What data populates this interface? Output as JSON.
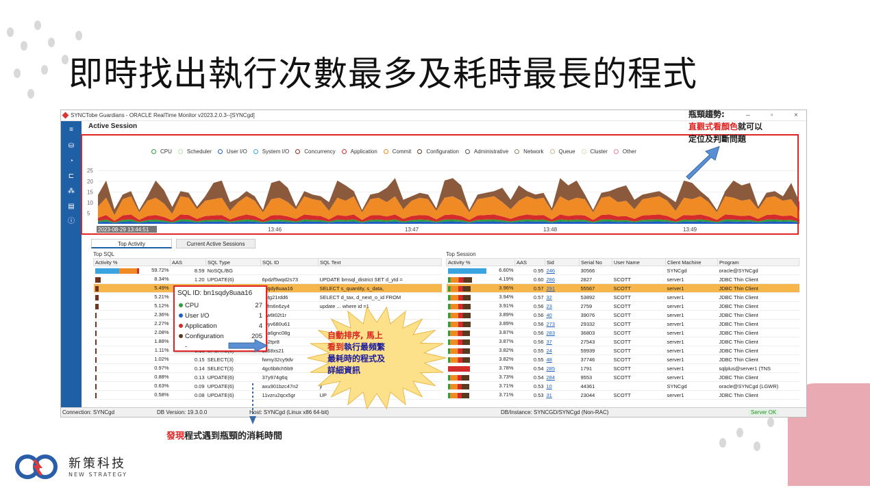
{
  "slide": {
    "title": "即時找出執行次數最多及耗時最長的程式",
    "callout_top": {
      "line1": "瓶頸趨勢:",
      "line2_red": "直觀式看顏色",
      "line2_rest": "就可以",
      "line3": "定位及判斷問題"
    },
    "callout_burst": {
      "line1": "自動排序, 馬上",
      "line2_a": "看到",
      "line2_b": "執行最頻繁",
      "line3": "最耗時的程式及",
      "line4": "詳細資訊"
    },
    "bottom_note": {
      "red": "發現",
      "rest": "程式遇到瓶頸的消耗時間"
    },
    "brand": {
      "name": "新策科技",
      "sub": "NEW STRATEGY"
    }
  },
  "app": {
    "window_title": "SYNCTobe Guardians - ORACLE RealTime Monitor v2023.2.0.3--[SYNCgd]",
    "section_title": "Active Session",
    "legend": [
      {
        "label": "CPU",
        "color": "#2e9e3e"
      },
      {
        "label": "Scheduler",
        "color": "#b8e0a8"
      },
      {
        "label": "User I/O",
        "color": "#1f5fc4"
      },
      {
        "label": "System I/O",
        "color": "#3aa4e0"
      },
      {
        "label": "Concurrency",
        "color": "#8b2c1c"
      },
      {
        "label": "Application",
        "color": "#d52b2b"
      },
      {
        "label": "Commit",
        "color": "#f08a24"
      },
      {
        "label": "Configuration",
        "color": "#5a3a1e"
      },
      {
        "label": "Administrative",
        "color": "#555555"
      },
      {
        "label": "Network",
        "color": "#8a8a6a"
      },
      {
        "label": "Queue",
        "color": "#c9b98a"
      },
      {
        "label": "Cluster",
        "color": "#e8d8b0"
      },
      {
        "label": "Other",
        "color": "#e97fa6"
      }
    ],
    "chart_data": {
      "type": "area",
      "y_ticks": [
        "25",
        "20",
        "15",
        "10",
        "5"
      ],
      "ylim": [
        0,
        27
      ],
      "x_ticks": [
        "2023-08-29 13:44:51",
        "13:46",
        "13:47",
        "13:48",
        "13:49"
      ],
      "series_summary": "stacked active sessions by wait class",
      "samples": [
        12,
        18,
        6,
        17,
        19,
        8,
        16,
        18,
        14,
        7,
        19,
        18,
        10,
        16,
        17,
        18,
        9,
        15,
        19,
        16,
        8,
        17,
        18,
        15,
        10,
        19,
        17,
        16,
        9,
        18,
        16,
        19,
        8,
        17,
        18,
        15,
        19,
        10,
        16,
        18,
        17,
        9,
        18,
        19,
        16,
        8,
        17,
        18,
        19,
        15,
        10,
        16,
        19,
        17,
        18,
        9,
        19,
        16,
        18,
        17,
        8,
        18,
        19,
        15,
        16,
        10,
        17,
        18,
        19,
        16,
        9,
        18,
        17,
        19,
        15,
        8,
        19,
        18,
        16,
        17,
        10,
        18,
        19,
        16,
        17,
        9
      ]
    },
    "tabs": [
      "Top Activity",
      "Current Active Sessions"
    ],
    "top_sql": {
      "label": "Top SQL",
      "columns": [
        "Activity %",
        "AAS",
        "SQL Type",
        "SQL ID",
        "SQL Text"
      ],
      "rows": [
        {
          "pct": "59.72%",
          "aas": "8.59",
          "type": "NoSQL/BG",
          "id": "",
          "text": ""
        },
        {
          "pct": "8.34%",
          "aas": "1.20",
          "type": "UPDATE(6)",
          "id": "6pdzf5wqd2s73",
          "text": "UPDATE bmsql_district   SET d_ytd ="
        },
        {
          "pct": "5.49%",
          "aas": "",
          "type": "",
          "id": "1sqdy8uaa16",
          "text": "SELECT s_quantity, s_data,"
        },
        {
          "pct": "5.21%",
          "aas": "",
          "type": "",
          "id": "74tg21rdd6",
          "text": "SELECT d_tax, d_next_o_id    FROM"
        },
        {
          "pct": "5.12%",
          "aas": "",
          "type": "",
          "id": "vzfm6n6zy4",
          "text": "update ... where id =1"
        },
        {
          "pct": "2.36%",
          "aas": "",
          "type": "",
          "id": "r7w6t02t1r",
          "text": ""
        },
        {
          "pct": "2.27%",
          "aas": "",
          "type": "",
          "id": "98yv680u61",
          "text": ""
        },
        {
          "pct": "2.08%",
          "aas": "",
          "type": "",
          "id": "v1a6gnc08g",
          "text": ""
        },
        {
          "pct": "1.88%",
          "aas": "",
          "type": "",
          "id": "962tpr8",
          "text": ""
        },
        {
          "pct": "1.11%",
          "aas": "0.16",
          "type": "UPDATE(6)",
          "id": "ok68xs21",
          "text": ""
        },
        {
          "pct": "1.02%",
          "aas": "0.15",
          "type": "SELECT(3)",
          "id": "fwmy32cy9dv",
          "text": ""
        },
        {
          "pct": "0.97%",
          "aas": "0.14",
          "type": "SELECT(3)",
          "id": "4gc6b8ch5b9",
          "text": ""
        },
        {
          "pct": "0.88%",
          "aas": "0.13",
          "type": "UPDATE(6)",
          "id": "37y974g6q",
          "text": ""
        },
        {
          "pct": "0.63%",
          "aas": "0.09",
          "type": "UPDATE(6)",
          "id": "axu901bzc47n2",
          "text": "y"
        },
        {
          "pct": "0.58%",
          "aas": "0.08",
          "type": "UPDATE(6)",
          "id": "11vzru2qcx5gr",
          "text": "UP"
        }
      ]
    },
    "top_session": {
      "label": "Top Session",
      "columns": [
        "Activity %",
        "AAS",
        "Sid",
        "Serial No",
        "User Name",
        "Client Machine",
        "Program"
      ],
      "rows": [
        {
          "pct": "6.60%",
          "aas": "0.95",
          "sid": "246",
          "serial": "30566",
          "user": "",
          "machine": "SYNCgd",
          "program": "oracle@SYNCgd"
        },
        {
          "pct": "4.19%",
          "aas": "0.60",
          "sid": "286",
          "serial": "2827",
          "user": "SCOTT",
          "machine": "server1",
          "program": "JDBC Thin Client"
        },
        {
          "pct": "3.96%",
          "aas": "0.57",
          "sid": "291",
          "serial": "55567",
          "user": "SCOTT",
          "machine": "server1",
          "program": "JDBC Thin Client"
        },
        {
          "pct": "3.94%",
          "aas": "0.57",
          "sid": "32",
          "serial": "53892",
          "user": "SCOTT",
          "machine": "server1",
          "program": "JDBC Thin Client"
        },
        {
          "pct": "3.91%",
          "aas": "0.56",
          "sid": "23",
          "serial": "2759",
          "user": "SCOTT",
          "machine": "server1",
          "program": "JDBC Thin Client"
        },
        {
          "pct": "3.89%",
          "aas": "0.56",
          "sid": "40",
          "serial": "39076",
          "user": "SCOTT",
          "machine": "server1",
          "program": "JDBC Thin Client"
        },
        {
          "pct": "3.89%",
          "aas": "0.56",
          "sid": "273",
          "serial": "29332",
          "user": "SCOTT",
          "machine": "server1",
          "program": "JDBC Thin Client"
        },
        {
          "pct": "3.87%",
          "aas": "0.56",
          "sid": "283",
          "serial": "36803",
          "user": "SCOTT",
          "machine": "server1",
          "program": "JDBC Thin Client"
        },
        {
          "pct": "3.87%",
          "aas": "0.56",
          "sid": "37",
          "serial": "27543",
          "user": "SCOTT",
          "machine": "server1",
          "program": "JDBC Thin Client"
        },
        {
          "pct": "3.82%",
          "aas": "0.55",
          "sid": "24",
          "serial": "59939",
          "user": "SCOTT",
          "machine": "server1",
          "program": "JDBC Thin Client"
        },
        {
          "pct": "3.82%",
          "aas": "0.55",
          "sid": "48",
          "serial": "37746",
          "user": "SCOTT",
          "machine": "server1",
          "program": "JDBC Thin Client"
        },
        {
          "pct": "3.78%",
          "aas": "0.54",
          "sid": "285",
          "serial": "1791",
          "user": "SCOTT",
          "machine": "server1",
          "program": "sqlplus@server1 (TNS"
        },
        {
          "pct": "3.73%",
          "aas": "0.54",
          "sid": "284",
          "serial": "9553",
          "user": "SCOTT",
          "machine": "server1",
          "program": "JDBC Thin Client"
        },
        {
          "pct": "3.71%",
          "aas": "0.53",
          "sid": "10",
          "serial": "44361",
          "user": "",
          "machine": "SYNCgd",
          "program": "oracle@SYNCgd (LGWR)"
        },
        {
          "pct": "3.71%",
          "aas": "0.53",
          "sid": "31",
          "serial": "23044",
          "user": "SCOTT",
          "machine": "server1",
          "program": "JDBC Thin Client"
        }
      ]
    },
    "tooltip": {
      "header": "SQL ID: bn1sqdy8uaa16",
      "rows": [
        {
          "label": "CPU",
          "value": "27",
          "color": "#2e9e3e"
        },
        {
          "label": "User I/O",
          "value": "1",
          "color": "#1f5fc4"
        },
        {
          "label": "Application",
          "value": "4",
          "color": "#d52b2b"
        },
        {
          "label": "Configuration",
          "value": "205",
          "color": "#5a3a1e"
        },
        {
          "label": "-",
          "value": "",
          "color": "#ffffff"
        }
      ]
    },
    "status": {
      "connection": "Connection: SYNCgd",
      "db_version": "DB Version: 19.3.0.0",
      "host": "Host: SYNCgd (Linux x86 64-bit)",
      "instance": "DB/Instance: SYNCGD/SYNCgd (Non-RAC)",
      "server": "Server OK"
    }
  }
}
